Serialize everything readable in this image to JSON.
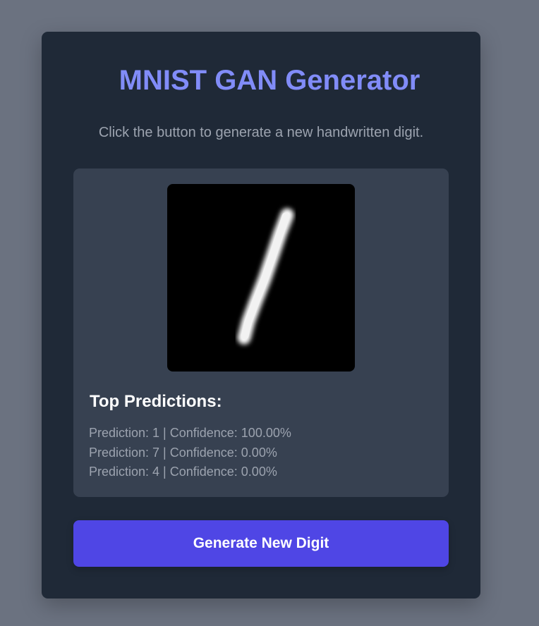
{
  "header": {
    "title": "MNIST GAN Generator",
    "subtitle": "Click the button to generate a new handwritten digit."
  },
  "result": {
    "image_alt": "Generated digit",
    "predictions_heading": "Top Predictions:",
    "predictions": [
      {
        "text": "Prediction: 1 | Confidence: 100.00%"
      },
      {
        "text": "Prediction: 7 | Confidence: 0.00%"
      },
      {
        "text": "Prediction: 4 | Confidence: 0.00%"
      }
    ]
  },
  "actions": {
    "generate_label": "Generate New Digit"
  },
  "colors": {
    "page_bg": "#6b7280",
    "card_bg": "#1f2937",
    "panel_bg": "#374151",
    "title": "#818cf8",
    "muted_text": "#9ca3af",
    "button_bg": "#4f46e5"
  }
}
